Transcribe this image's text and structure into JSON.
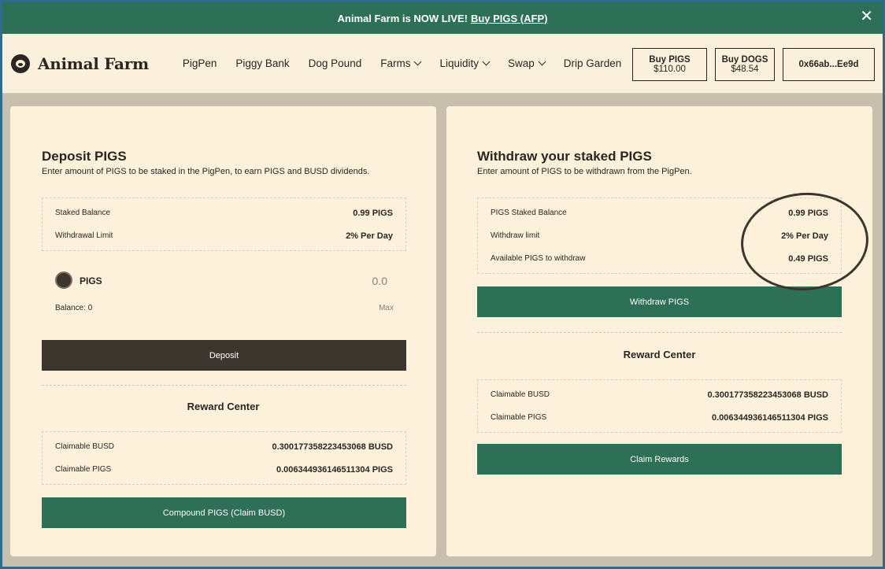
{
  "banner": {
    "text": "Animal Farm is NOW LIVE!",
    "link": "Buy PIGS (AFP)",
    "close": "✕"
  },
  "nav": {
    "brand": "Animal Farm",
    "items": [
      {
        "label": "PigPen",
        "dropdown": false
      },
      {
        "label": "Piggy Bank",
        "dropdown": false
      },
      {
        "label": "Dog Pound",
        "dropdown": false
      },
      {
        "label": "Farms",
        "dropdown": true
      },
      {
        "label": "Liquidity",
        "dropdown": true
      },
      {
        "label": "Swap",
        "dropdown": true
      },
      {
        "label": "Drip Garden",
        "dropdown": false
      }
    ],
    "buy_pigs": {
      "title": "Buy PIGS",
      "price": "$110.00"
    },
    "buy_dogs": {
      "title": "Buy DOGS",
      "price": "$48.54"
    },
    "wallet": "0x66ab...Ee9d"
  },
  "deposit": {
    "title": "Deposit PIGS",
    "subtitle": "Enter amount of PIGS to be staked in the PigPen, to earn PIGS and BUSD dividends.",
    "staked_label": "Staked Balance",
    "staked_value": "0.99 PIGS",
    "limit_label": "Withdrawal Limit",
    "limit_value": "2% Per Day",
    "token": "PIGS",
    "amount": "0.0",
    "balance": "Balance: 0",
    "max": "Max",
    "button": "Deposit",
    "reward_title": "Reward Center",
    "busd_label": "Claimable BUSD",
    "busd_value": "0.300177358223453068 BUSD",
    "pigs_label": "Claimable PIGS",
    "pigs_value": "0.006344936146511304 PIGS",
    "compound_button": "Compound PIGS (Claim BUSD)"
  },
  "withdraw": {
    "title": "Withdraw your staked PIGS",
    "subtitle": "Enter amount of PIGS to be withdrawn from the PigPen.",
    "staked_label": "PIGS Staked Balance",
    "staked_value": "0.99 PIGS",
    "limit_label": "Withdraw limit",
    "limit_value": "2% Per Day",
    "available_label": "Available PIGS to withdraw",
    "available_value": "0.49 PIGS",
    "button": "Withdraw PIGS",
    "reward_title": "Reward Center",
    "busd_label": "Claimable BUSD",
    "busd_value": "0.300177358223453068 BUSD",
    "pigs_label": "Claimable PIGS",
    "pigs_value": "0.006344936146511304 PIGS",
    "claim_button": "Claim Rewards"
  },
  "colors": {
    "accent_green": "#2e7057",
    "dark_button": "#3d362e",
    "card_bg": "#fdf1dc",
    "page_bg": "#c9bfae"
  }
}
